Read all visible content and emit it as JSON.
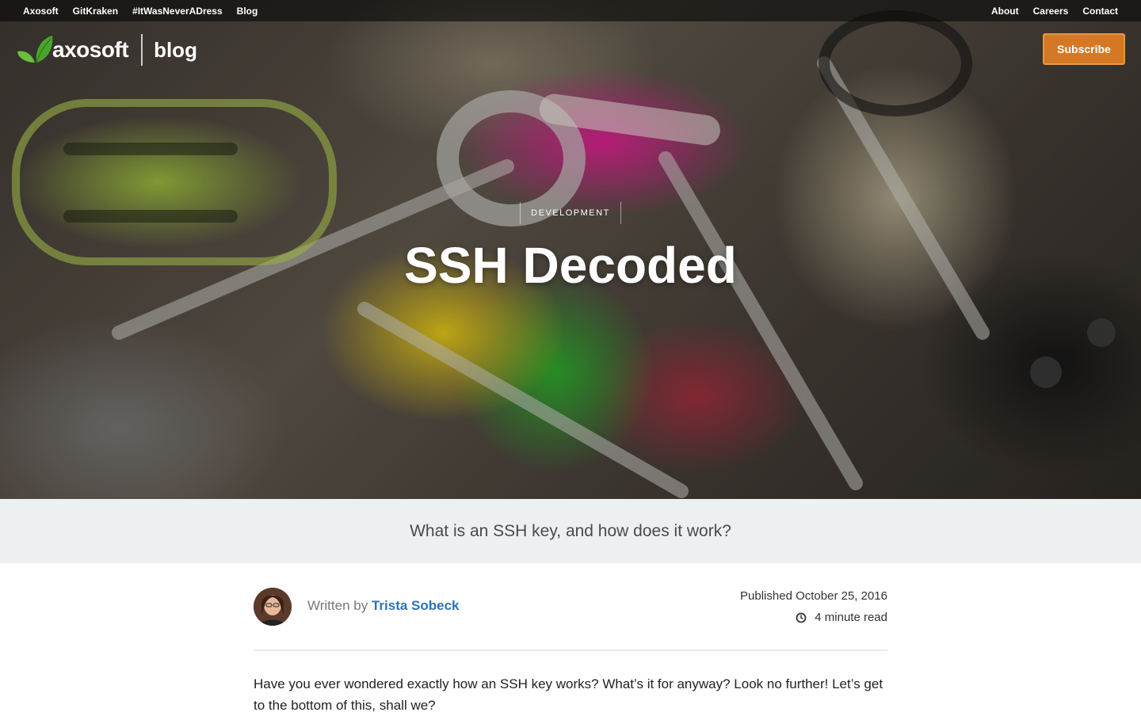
{
  "topnav": {
    "left": [
      "Axosoft",
      "GitKraken",
      "#ItWasNeverADress",
      "Blog"
    ],
    "right": [
      "About",
      "Careers",
      "Contact"
    ]
  },
  "logo": {
    "brand": "axosoft",
    "section": "blog"
  },
  "subscribe_label": "Subscribe",
  "hero": {
    "category": "DEVELOPMENT",
    "title": "SSH Decoded"
  },
  "subtitle": "What is an SSH key, and how does it work?",
  "meta": {
    "written_by": "Written by",
    "author": "Trista Sobeck",
    "published": "Published October 25, 2016",
    "read_time": "4 minute read"
  },
  "intro": "Have you ever wondered exactly how an SSH key works? What’s it for anyway? Look no further! Let’s get to the bottom of this, shall we?",
  "colors": {
    "accent": "#d47826",
    "link": "#2f73b6",
    "band": "#edf0f1"
  },
  "icons": [
    "leaf-icon",
    "clock-icon"
  ]
}
